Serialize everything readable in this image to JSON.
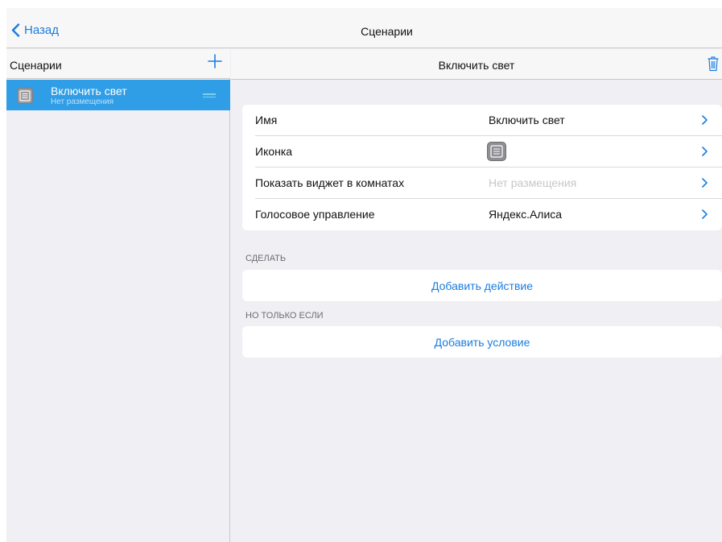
{
  "nav": {
    "back_label": "Назад",
    "title": "Сценарии"
  },
  "sidebar": {
    "title": "Сценарии",
    "items": [
      {
        "name": "Включить свет",
        "subtitle": "Нет размещения"
      }
    ]
  },
  "detail": {
    "title": "Включить свет",
    "properties": [
      {
        "label": "Имя",
        "value": "Включить свет"
      },
      {
        "label": "Иконка",
        "value": ""
      },
      {
        "label": "Показать виджет в комнатах",
        "value": "Нет размещения"
      },
      {
        "label": "Голосовое управление",
        "value": "Яндекс.Алиса"
      }
    ],
    "do_section": {
      "label": "СДЕЛАТЬ",
      "button": "Добавить действие"
    },
    "if_section": {
      "label": "НО ТОЛЬКО ЕСЛИ",
      "button": "Добавить условие"
    }
  },
  "colors": {
    "accent": "#1a7de0",
    "selected_row": "#2f9ee6",
    "background": "#efeff4",
    "muted_text": "#c7c7cc"
  },
  "icons": [
    "chevron-left-icon",
    "plus-icon",
    "list-icon",
    "drag-handle-icon",
    "trash-icon",
    "chevron-right-icon"
  ]
}
